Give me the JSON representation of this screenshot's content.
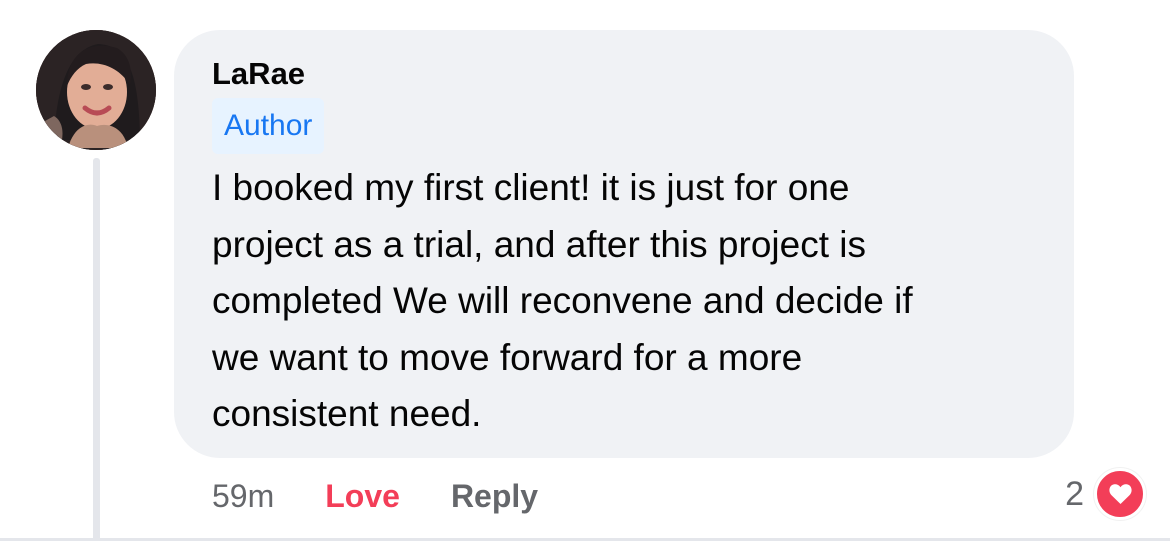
{
  "comment": {
    "author": "LaRae",
    "badge": "Author",
    "text": "I booked my first client! it is just for one\nproject as a trial, and after this project is\ncompleted We will reconvene and decide if\nwe want to move forward for a more\nconsistent need.",
    "timestamp": "59m",
    "love_label": "Love",
    "reply_label": "Reply",
    "reaction_count": "2",
    "reaction_type": "heart-icon"
  },
  "colors": {
    "bubble": "#f0f2f5",
    "badge_bg": "#e7f3ff",
    "badge_text": "#1877f2",
    "love": "#f33e58",
    "muted": "#65676b"
  }
}
